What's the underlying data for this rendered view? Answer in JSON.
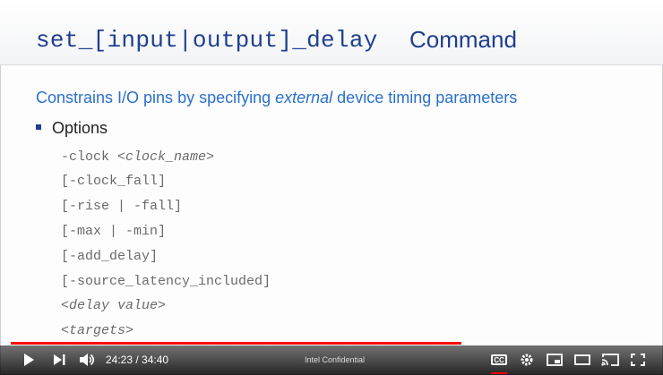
{
  "slide": {
    "title_command": "set_[input|output]_delay",
    "title_word": "Command",
    "subtitle_before": "Constrains I/O pins by specifying ",
    "subtitle_emph": "external",
    "subtitle_after": " device timing parameters",
    "bullet": "Options",
    "options": [
      {
        "prefix": "-clock ",
        "arg": "<clock_name>"
      },
      {
        "prefix": "[-clock_fall]",
        "arg": ""
      },
      {
        "prefix": "[-rise | -fall]",
        "arg": ""
      },
      {
        "prefix": "[-max | -min]",
        "arg": ""
      },
      {
        "prefix": "[-add_delay]",
        "arg": ""
      },
      {
        "prefix": "[-source_latency_included]",
        "arg": ""
      },
      {
        "prefix": "",
        "arg": "<delay value>"
      },
      {
        "prefix": "",
        "arg": "<targets>"
      }
    ]
  },
  "player": {
    "time_display": "24:23 / 34:40",
    "footer_text": "Intel Confidential",
    "progress_fraction": 0.7026,
    "buffer_fraction": 0.71,
    "cc_label": "CC",
    "accent_color": "#ff0000"
  }
}
